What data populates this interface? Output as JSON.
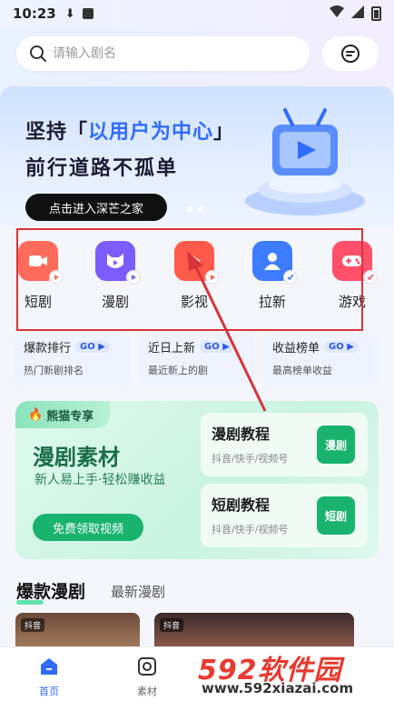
{
  "status_bar": {
    "time": "10:23"
  },
  "search": {
    "placeholder": "请输入剧名"
  },
  "banner": {
    "line1_prefix": "坚持「",
    "line1_highlight": "以用户为中心",
    "line1_suffix": "」",
    "line2": "前行道路不孤单",
    "cta_label": "点击进入深芒之家"
  },
  "categories": [
    {
      "label": "短剧",
      "color": "#ff6b5a",
      "icon": "video-camera-icon"
    },
    {
      "label": "漫剧",
      "color": "#7b5cff",
      "icon": "cat-face-icon"
    },
    {
      "label": "影视",
      "color": "#ff5a4a",
      "icon": "play-icon"
    },
    {
      "label": "拉新",
      "color": "#3d7bff",
      "icon": "user-add-icon"
    },
    {
      "label": "游戏",
      "color": "#ff4f6a",
      "icon": "gamepad-icon"
    }
  ],
  "quick_links": [
    {
      "title": "爆款排行",
      "go": "GO",
      "sub": "热门新剧排名"
    },
    {
      "title": "近日上新",
      "go": "GO",
      "sub": "最近新上的剧"
    },
    {
      "title": "收益榜单",
      "go": "GO",
      "sub": "最高榜单收益"
    }
  ],
  "promo": {
    "tag": "熊猫专享",
    "title": "漫剧素材",
    "subtitle": "新人易上手·轻松赚收益",
    "button": "免费领取视频",
    "tutorials": [
      {
        "title": "漫剧教程",
        "sub": "抖音/快手/视频号",
        "btn": "漫剧"
      },
      {
        "title": "短剧教程",
        "sub": "抖音/快手/视频号",
        "btn": "短剧"
      }
    ]
  },
  "sections": {
    "tab1": "爆款漫剧",
    "tab2": "最新漫剧"
  },
  "thumbs": [
    {
      "tag": "抖音"
    },
    {
      "tag": "抖音"
    }
  ],
  "tab_bar": {
    "home": "首页",
    "material": "素材"
  },
  "watermark": {
    "logo": "592软件园",
    "url": "www.592xiazai.com"
  },
  "colors": {
    "accent": "#2f6bff",
    "green": "#19b36e",
    "annotation": "#d9333a"
  }
}
